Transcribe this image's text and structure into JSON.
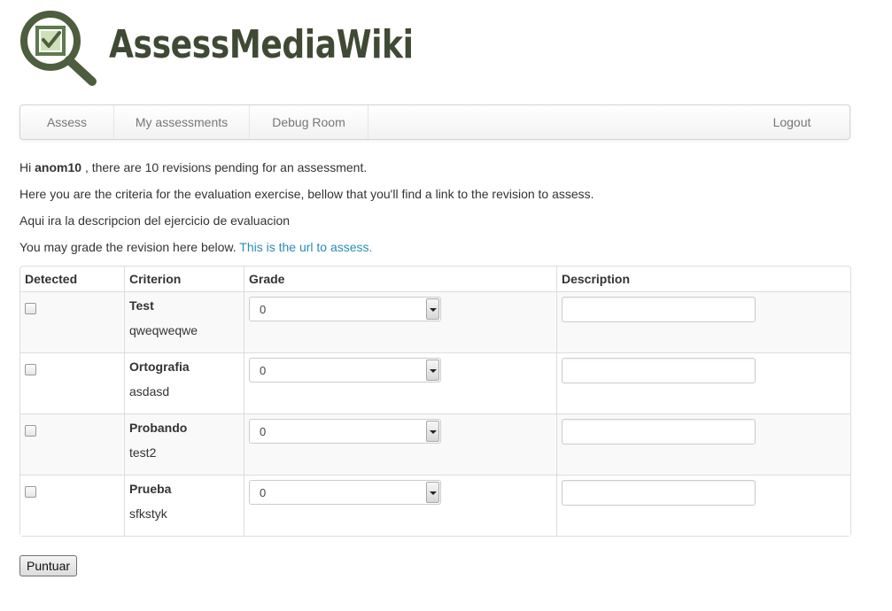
{
  "app": {
    "title": "AssessMediaWiki",
    "logo_icon": "magnifier-checkbox-icon",
    "brand_color": "#4a5a3a",
    "accent_green": "#5d7a4d"
  },
  "nav": {
    "items": [
      {
        "label": "Assess"
      },
      {
        "label": "My assessments"
      },
      {
        "label": "Debug Room"
      }
    ],
    "logout_label": "Logout"
  },
  "intro": {
    "hi": "Hi",
    "username": "anom10",
    "pending_text": ", there are 10 revisions pending for an assessment.",
    "criteria_text": "Here you are the criteria for the evaluation exercise, bellow that you'll find a link to the revision to assess.",
    "description_text": "Aqui ira la descripcion del ejercicio de evaluacion",
    "grade_text": "You may grade the revision here below.",
    "link_text": "This is the url to assess."
  },
  "table": {
    "headers": [
      "Detected",
      "Criterion",
      "Grade",
      "Description"
    ],
    "rows": [
      {
        "name": "Test",
        "description": "qweqweqwe",
        "grade": "0",
        "detected": false,
        "comment": ""
      },
      {
        "name": "Ortografia",
        "description": "asdasd",
        "grade": "0",
        "detected": false,
        "comment": ""
      },
      {
        "name": "Probando",
        "description": "test2",
        "grade": "0",
        "detected": false,
        "comment": ""
      },
      {
        "name": "Prueba",
        "description": "sfkstyk",
        "grade": "0",
        "detected": false,
        "comment": ""
      }
    ]
  },
  "submit_label": "Puntuar"
}
